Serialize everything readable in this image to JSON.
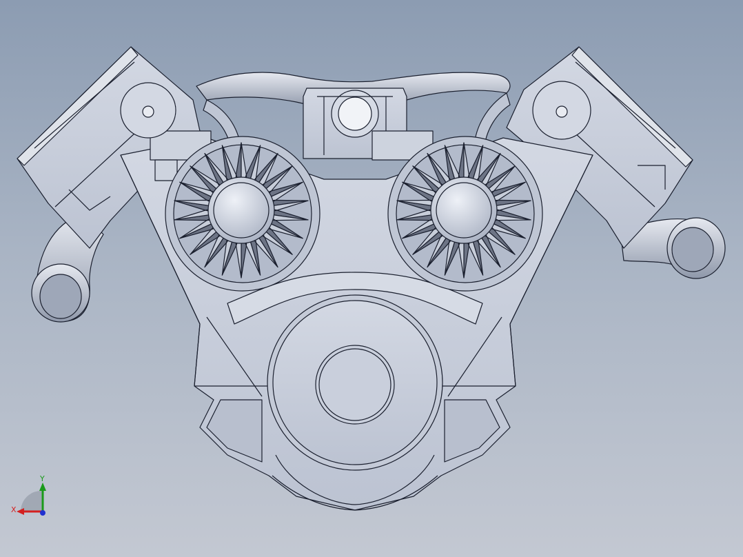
{
  "viewport": {
    "background_top": "#8c9cb2",
    "background_bottom": "#c3c8d2",
    "model": "engine-v-block-front-view",
    "model_color": "#c9cfdc",
    "edge_color": "#1a1f2e"
  },
  "triad": {
    "x_label": "X",
    "y_label": "Y",
    "x_color": "#d42020",
    "y_color": "#1a9a1a",
    "z_color": "#2030d0"
  }
}
